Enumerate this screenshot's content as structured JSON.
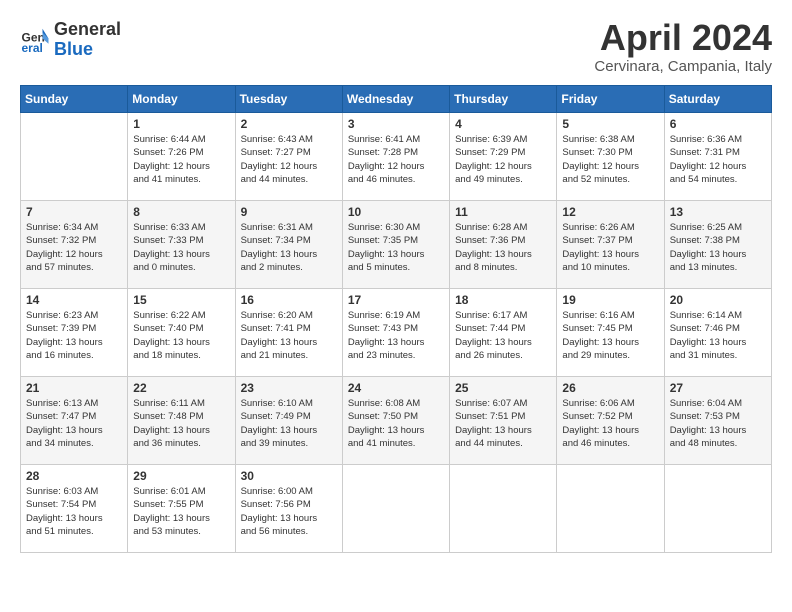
{
  "header": {
    "logo_line1": "General",
    "logo_line2": "Blue",
    "month": "April 2024",
    "location": "Cervinara, Campania, Italy"
  },
  "days_of_week": [
    "Sunday",
    "Monday",
    "Tuesday",
    "Wednesday",
    "Thursday",
    "Friday",
    "Saturday"
  ],
  "weeks": [
    [
      {
        "day": "",
        "info": ""
      },
      {
        "day": "1",
        "info": "Sunrise: 6:44 AM\nSunset: 7:26 PM\nDaylight: 12 hours\nand 41 minutes."
      },
      {
        "day": "2",
        "info": "Sunrise: 6:43 AM\nSunset: 7:27 PM\nDaylight: 12 hours\nand 44 minutes."
      },
      {
        "day": "3",
        "info": "Sunrise: 6:41 AM\nSunset: 7:28 PM\nDaylight: 12 hours\nand 46 minutes."
      },
      {
        "day": "4",
        "info": "Sunrise: 6:39 AM\nSunset: 7:29 PM\nDaylight: 12 hours\nand 49 minutes."
      },
      {
        "day": "5",
        "info": "Sunrise: 6:38 AM\nSunset: 7:30 PM\nDaylight: 12 hours\nand 52 minutes."
      },
      {
        "day": "6",
        "info": "Sunrise: 6:36 AM\nSunset: 7:31 PM\nDaylight: 12 hours\nand 54 minutes."
      }
    ],
    [
      {
        "day": "7",
        "info": "Sunrise: 6:34 AM\nSunset: 7:32 PM\nDaylight: 12 hours\nand 57 minutes."
      },
      {
        "day": "8",
        "info": "Sunrise: 6:33 AM\nSunset: 7:33 PM\nDaylight: 13 hours\nand 0 minutes."
      },
      {
        "day": "9",
        "info": "Sunrise: 6:31 AM\nSunset: 7:34 PM\nDaylight: 13 hours\nand 2 minutes."
      },
      {
        "day": "10",
        "info": "Sunrise: 6:30 AM\nSunset: 7:35 PM\nDaylight: 13 hours\nand 5 minutes."
      },
      {
        "day": "11",
        "info": "Sunrise: 6:28 AM\nSunset: 7:36 PM\nDaylight: 13 hours\nand 8 minutes."
      },
      {
        "day": "12",
        "info": "Sunrise: 6:26 AM\nSunset: 7:37 PM\nDaylight: 13 hours\nand 10 minutes."
      },
      {
        "day": "13",
        "info": "Sunrise: 6:25 AM\nSunset: 7:38 PM\nDaylight: 13 hours\nand 13 minutes."
      }
    ],
    [
      {
        "day": "14",
        "info": "Sunrise: 6:23 AM\nSunset: 7:39 PM\nDaylight: 13 hours\nand 16 minutes."
      },
      {
        "day": "15",
        "info": "Sunrise: 6:22 AM\nSunset: 7:40 PM\nDaylight: 13 hours\nand 18 minutes."
      },
      {
        "day": "16",
        "info": "Sunrise: 6:20 AM\nSunset: 7:41 PM\nDaylight: 13 hours\nand 21 minutes."
      },
      {
        "day": "17",
        "info": "Sunrise: 6:19 AM\nSunset: 7:43 PM\nDaylight: 13 hours\nand 23 minutes."
      },
      {
        "day": "18",
        "info": "Sunrise: 6:17 AM\nSunset: 7:44 PM\nDaylight: 13 hours\nand 26 minutes."
      },
      {
        "day": "19",
        "info": "Sunrise: 6:16 AM\nSunset: 7:45 PM\nDaylight: 13 hours\nand 29 minutes."
      },
      {
        "day": "20",
        "info": "Sunrise: 6:14 AM\nSunset: 7:46 PM\nDaylight: 13 hours\nand 31 minutes."
      }
    ],
    [
      {
        "day": "21",
        "info": "Sunrise: 6:13 AM\nSunset: 7:47 PM\nDaylight: 13 hours\nand 34 minutes."
      },
      {
        "day": "22",
        "info": "Sunrise: 6:11 AM\nSunset: 7:48 PM\nDaylight: 13 hours\nand 36 minutes."
      },
      {
        "day": "23",
        "info": "Sunrise: 6:10 AM\nSunset: 7:49 PM\nDaylight: 13 hours\nand 39 minutes."
      },
      {
        "day": "24",
        "info": "Sunrise: 6:08 AM\nSunset: 7:50 PM\nDaylight: 13 hours\nand 41 minutes."
      },
      {
        "day": "25",
        "info": "Sunrise: 6:07 AM\nSunset: 7:51 PM\nDaylight: 13 hours\nand 44 minutes."
      },
      {
        "day": "26",
        "info": "Sunrise: 6:06 AM\nSunset: 7:52 PM\nDaylight: 13 hours\nand 46 minutes."
      },
      {
        "day": "27",
        "info": "Sunrise: 6:04 AM\nSunset: 7:53 PM\nDaylight: 13 hours\nand 48 minutes."
      }
    ],
    [
      {
        "day": "28",
        "info": "Sunrise: 6:03 AM\nSunset: 7:54 PM\nDaylight: 13 hours\nand 51 minutes."
      },
      {
        "day": "29",
        "info": "Sunrise: 6:01 AM\nSunset: 7:55 PM\nDaylight: 13 hours\nand 53 minutes."
      },
      {
        "day": "30",
        "info": "Sunrise: 6:00 AM\nSunset: 7:56 PM\nDaylight: 13 hours\nand 56 minutes."
      },
      {
        "day": "",
        "info": ""
      },
      {
        "day": "",
        "info": ""
      },
      {
        "day": "",
        "info": ""
      },
      {
        "day": "",
        "info": ""
      }
    ]
  ]
}
